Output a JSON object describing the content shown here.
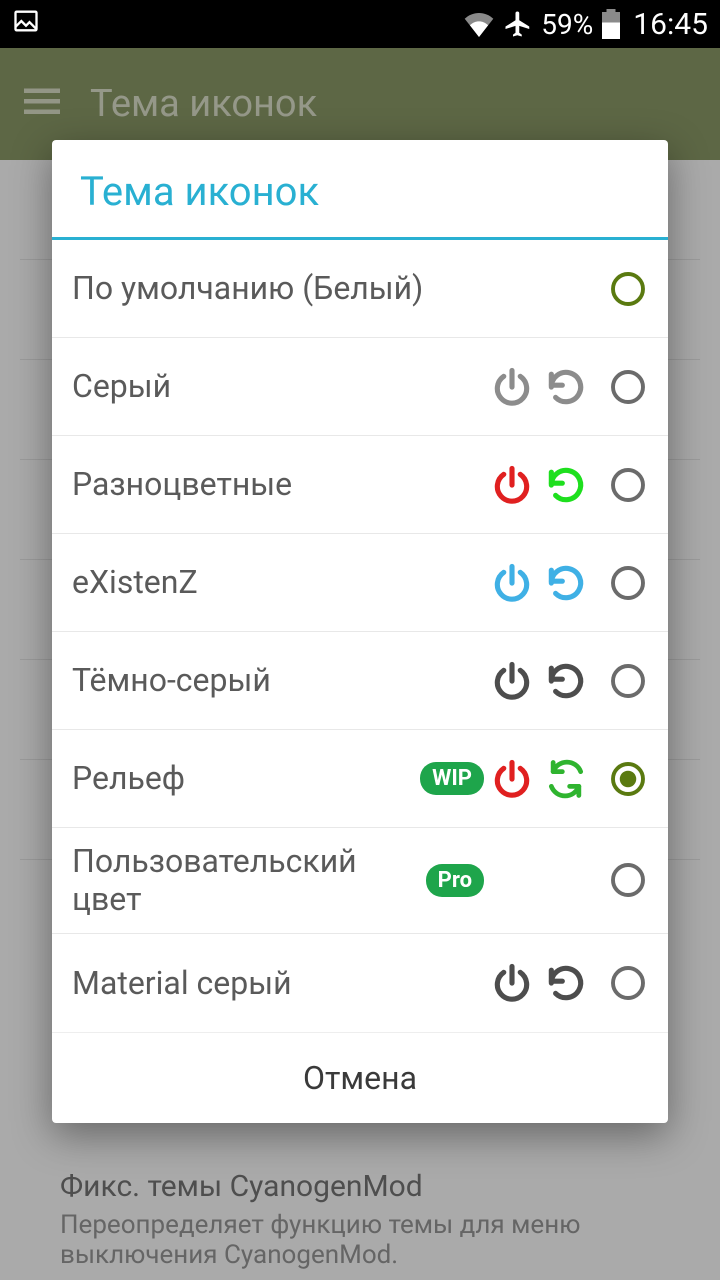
{
  "status": {
    "battery_text": "59%",
    "clock": "16:45"
  },
  "appbar": {
    "title": "Тема иконок"
  },
  "background": {
    "bottom_title": "Фикс. темы CyanogenMod",
    "bottom_subtitle": "Переопределяет функцию темы для меню выключения CyanogenMod."
  },
  "dialog": {
    "title": "Тема иконок",
    "cancel": "Отмена",
    "themes": [
      {
        "label": "По умолчанию (Белый)",
        "badge": null,
        "power": "#ffffff",
        "refresh": "#ffffff",
        "refresh_type": "rotate",
        "selected": false,
        "radio_color": "#5a7a10"
      },
      {
        "label": "Серый",
        "badge": null,
        "power": "#8c8c8c",
        "refresh": "#8c8c8c",
        "refresh_type": "rotate",
        "selected": false,
        "radio_color": "#6b6b6b"
      },
      {
        "label": "Разноцветные",
        "badge": null,
        "power": "#e02020",
        "refresh": "#1edf1e",
        "refresh_type": "rotate",
        "selected": false,
        "radio_color": "#6b6b6b"
      },
      {
        "label": "eXistenZ",
        "badge": null,
        "power": "#3fb0e5",
        "refresh": "#3fb0e5",
        "refresh_type": "rotate",
        "selected": false,
        "radio_color": "#6b6b6b"
      },
      {
        "label": "Тёмно-серый",
        "badge": null,
        "power": "#4d4d4d",
        "refresh": "#4d4d4d",
        "refresh_type": "rotate",
        "selected": false,
        "radio_color": "#6b6b6b"
      },
      {
        "label": "Рельеф",
        "badge": "WIP",
        "power": "#e02020",
        "refresh": "#2fb42f",
        "refresh_type": "sync",
        "selected": true,
        "radio_color": "#5a7a10"
      },
      {
        "label": "Пользовательский цвет",
        "badge": "Pro",
        "power": "#ffffff",
        "refresh": "#ffffff",
        "refresh_type": "rotate",
        "selected": false,
        "radio_color": "#6b6b6b"
      },
      {
        "label": "Material серый",
        "badge": null,
        "power": "#4d4d4d",
        "refresh": "#4d4d4d",
        "refresh_type": "rotate",
        "selected": false,
        "radio_color": "#6b6b6b"
      }
    ]
  }
}
